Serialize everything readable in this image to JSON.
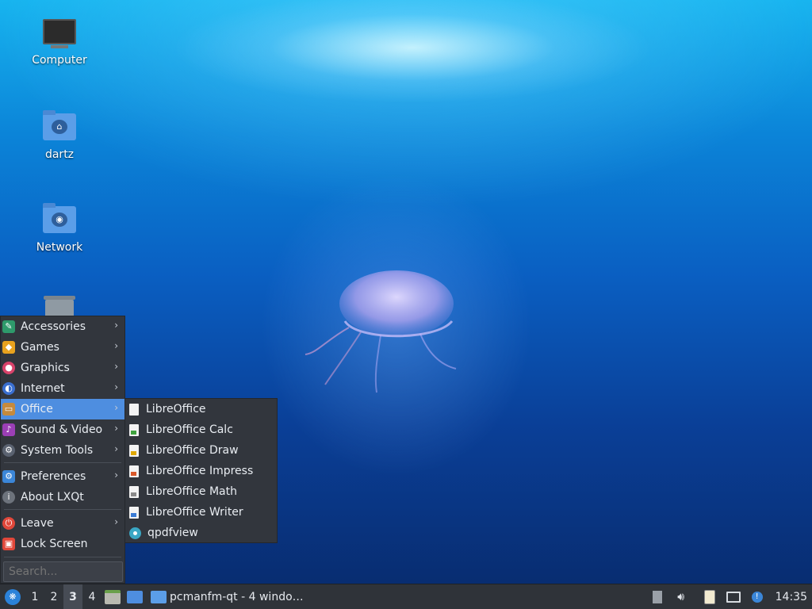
{
  "desktop": {
    "icons": [
      {
        "label": "Computer",
        "icon": "computer-icon"
      },
      {
        "label": "dartz",
        "icon": "home-folder-icon"
      },
      {
        "label": "Network",
        "icon": "network-folder-icon"
      },
      {
        "label": "",
        "icon": "trash-icon"
      }
    ]
  },
  "menu": {
    "items": [
      {
        "label": "Accessories",
        "icon": "accessories-icon",
        "color": "#2e9a6b"
      },
      {
        "label": "Games",
        "icon": "games-icon",
        "color": "#e8a21e"
      },
      {
        "label": "Graphics",
        "icon": "graphics-icon",
        "color": "#d9436b"
      },
      {
        "label": "Internet",
        "icon": "internet-icon",
        "color": "#3a6fd0"
      },
      {
        "label": "Office",
        "icon": "office-icon",
        "color": "#c58a3c"
      },
      {
        "label": "Sound & Video",
        "icon": "sound-video-icon",
        "color": "#9b3fb5"
      },
      {
        "label": "System Tools",
        "icon": "system-tools-icon",
        "color": "#5a6270"
      },
      {
        "label": "Preferences",
        "icon": "preferences-icon",
        "color": "#3b86d8"
      },
      {
        "label": "About LXQt",
        "icon": "about-icon",
        "color": "#6d737c"
      },
      {
        "label": "Leave",
        "icon": "leave-icon",
        "color": "#e0473a"
      },
      {
        "label": "Lock Screen",
        "icon": "lock-icon",
        "color": "#e0473a"
      }
    ],
    "search_placeholder": "Search..."
  },
  "submenu": {
    "items": [
      {
        "label": "LibreOffice"
      },
      {
        "label": "LibreOffice Calc"
      },
      {
        "label": "LibreOffice Draw"
      },
      {
        "label": "LibreOffice Impress"
      },
      {
        "label": "LibreOffice Math"
      },
      {
        "label": "LibreOffice Writer"
      },
      {
        "label": "qpdfview"
      }
    ]
  },
  "taskbar": {
    "desktops": [
      "1",
      "2",
      "3",
      "4"
    ],
    "current_desktop": "3",
    "task_label": "pcmanfm-qt - 4 windo…",
    "clock": "14:35"
  },
  "colors": {
    "menu_bg": "#32363d",
    "active_highlight": "#4e8ee0",
    "taskbar_bg": "#2f3339"
  }
}
